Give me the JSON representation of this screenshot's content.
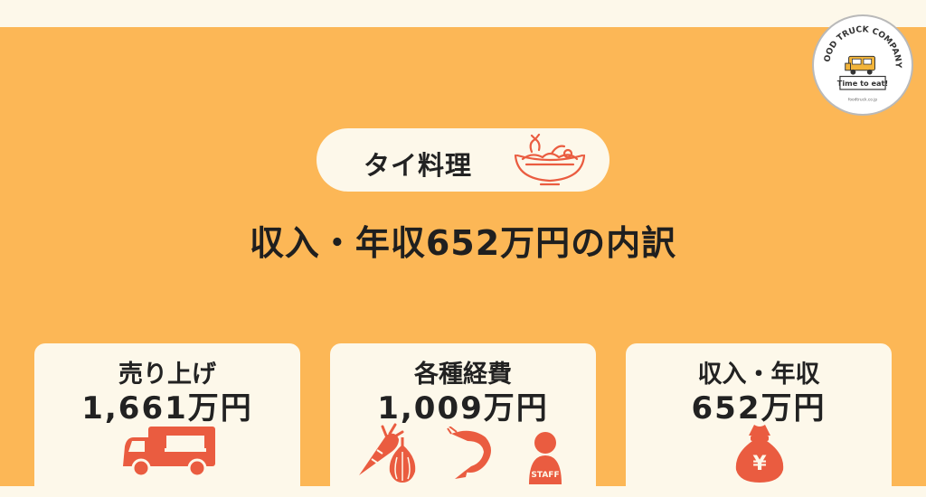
{
  "logo": {
    "brand": "FOOD TRUCK COMPANY",
    "tagline": "Time to eat!",
    "url": "foodtruck.co.jp",
    "icon": "food-truck-icon"
  },
  "category": {
    "label": "タイ料理",
    "icon": "tom-yum-bowl-icon"
  },
  "headline": "収入・年収652万円の内訳",
  "cards": [
    {
      "title": "売り上げ",
      "value": "1,661万円",
      "icons": [
        "food-truck-icon"
      ]
    },
    {
      "title": "各種経費",
      "value": "1,009万円",
      "icons": [
        "carrot-icon",
        "garlic-icon",
        "shrimp-icon",
        "staff-icon"
      ]
    },
    {
      "title": "収入・年収",
      "value": "652万円",
      "icons": [
        "money-bag-icon"
      ]
    }
  ],
  "staff_label": "STAFF",
  "yen_symbol": "¥",
  "colors": {
    "background": "#fcb756",
    "card": "#fdf8ea",
    "icon_accent": "#ea5c40",
    "text": "#222222"
  }
}
